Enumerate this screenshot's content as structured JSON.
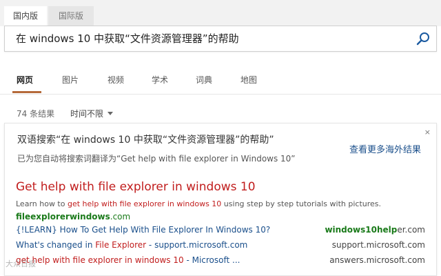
{
  "market_tabs": [
    "国内版",
    "国际版"
  ],
  "search": {
    "query": "在 windows 10 中获取“文件资源管理器”的帮助"
  },
  "nav": [
    "网页",
    "图片",
    "视频",
    "学术",
    "词典",
    "地图"
  ],
  "results_meta": {
    "count": "74 条结果",
    "time_filter": "时间不限"
  },
  "card": {
    "close": "×",
    "bilingual_title": "双语搜索“在 windows 10 中获取“文件资源管理器”的帮助”",
    "auto_translated": "已为您自动将搜索词翻译为“Get help with file explorer in Windows 10”",
    "more_overseas": "查看更多海外结果"
  },
  "result": {
    "title": "Get help with file explorer in windows 10",
    "snippet_pre": "Learn how to ",
    "snippet_hl": "get help with file explorer in windows 10",
    "snippet_post": " using step by step tutorials with pictures.",
    "url_bold": "fileexplorerwindows",
    "url_rest": ".com"
  },
  "deep_links": [
    {
      "pre": "{!LEARN} How To Get Help With File Explorer In Windows 10?",
      "hl": "",
      "post": "",
      "domain_bold": "windows10help",
      "domain_rest": "er.com"
    },
    {
      "pre": "What's changed in ",
      "hl": "File Explorer",
      "post": " - support.microsoft.com",
      "domain_bold": "",
      "domain_rest": "support.microsoft.com"
    },
    {
      "pre": "",
      "hl": "get help with file explorer in windows 10",
      "post": " - Microsoft ...",
      "domain_bold": "",
      "domain_rest": "answers.microsoft.com"
    }
  ],
  "watermark": "大众日报"
}
